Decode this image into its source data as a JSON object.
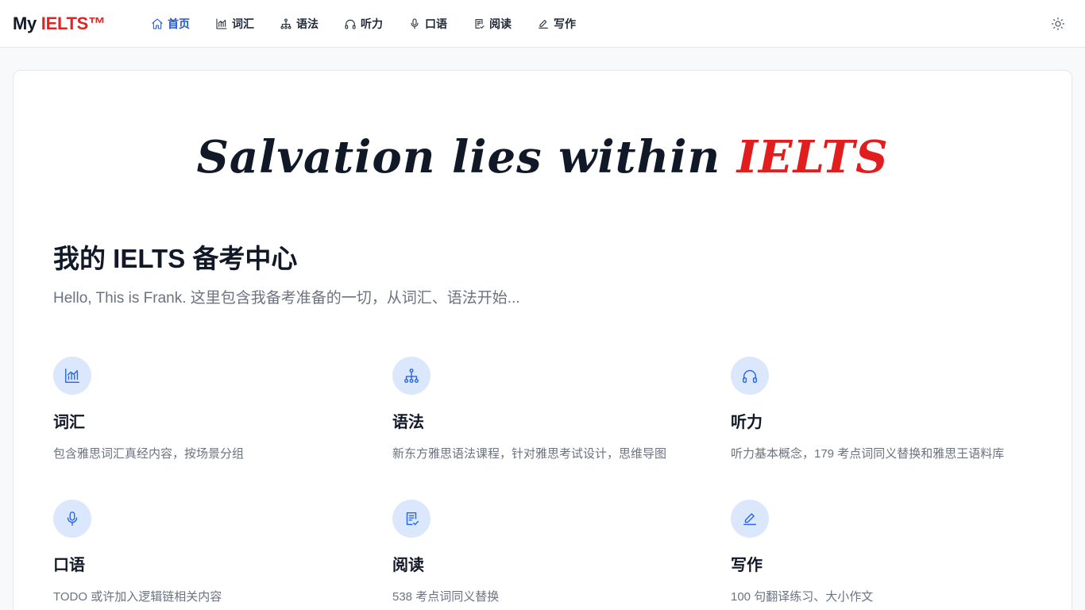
{
  "brand": {
    "prefix": "My ",
    "accent": "IELTS™"
  },
  "nav": {
    "items": [
      {
        "label": "首页",
        "icon": "home-icon",
        "active": true
      },
      {
        "label": "词汇",
        "icon": "chart-icon",
        "active": false
      },
      {
        "label": "语法",
        "icon": "hierarchy-icon",
        "active": false
      },
      {
        "label": "听力",
        "icon": "headphones-icon",
        "active": false
      },
      {
        "label": "口语",
        "icon": "microphone-icon",
        "active": false
      },
      {
        "label": "阅读",
        "icon": "document-check-icon",
        "active": false
      },
      {
        "label": "写作",
        "icon": "pencil-icon",
        "active": false
      }
    ]
  },
  "theme_toggle": {
    "icon": "sun-icon"
  },
  "hero": {
    "text": "Salvation lies within",
    "accent": "IELTS"
  },
  "page": {
    "title": "我的 IELTS 备考中心",
    "subtitle": "Hello, This is Frank. 这里包含我备考准备的一切，从词汇、语法开始..."
  },
  "features": [
    {
      "title": "词汇",
      "desc": "包含雅思词汇真经内容，按场景分组",
      "icon": "chart-icon"
    },
    {
      "title": "语法",
      "desc": "新东方雅思语法课程，针对雅思考试设计，思维导图",
      "icon": "hierarchy-icon"
    },
    {
      "title": "听力",
      "desc": "听力基本概念，179 考点词同义替换和雅思王语料库",
      "icon": "headphones-icon"
    },
    {
      "title": "口语",
      "desc": "TODO 或许加入逻辑链相关内容",
      "icon": "microphone-icon"
    },
    {
      "title": "阅读",
      "desc": "538 考点词同义替换",
      "icon": "document-check-icon"
    },
    {
      "title": "写作",
      "desc": "100 句翻译练习、大小作文",
      "icon": "pencil-icon"
    }
  ],
  "colors": {
    "brand_accent": "#dc2626",
    "nav_active": "#2156d9",
    "icon_blue": "#2563eb",
    "icon_circle_bg": "#dbe7fd",
    "muted_text": "#6b7280"
  }
}
